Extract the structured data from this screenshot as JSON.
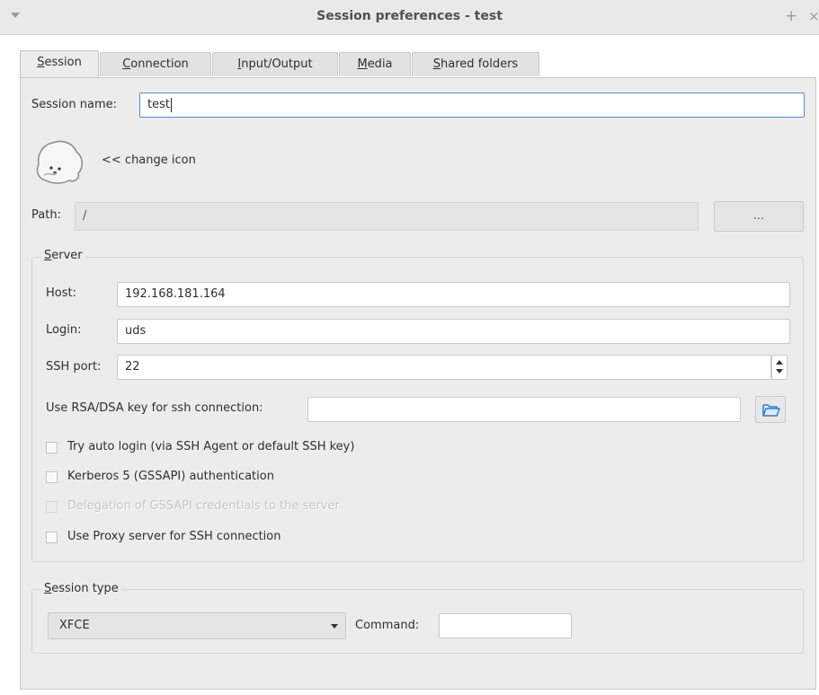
{
  "window": {
    "title": "Session preferences - test",
    "plus_glyph": "+",
    "close_glyph": "×"
  },
  "tabs": [
    {
      "label": "Session",
      "mnemonic": "S",
      "rest": "ession",
      "active": true
    },
    {
      "label": "Connection",
      "mnemonic": "C",
      "rest": "onnection",
      "active": false
    },
    {
      "label": "Input/Output",
      "mnemonic": "I",
      "rest": "nput/Output",
      "active": false
    },
    {
      "label": "Media",
      "mnemonic": "M",
      "rest": "edia",
      "active": false
    },
    {
      "label": "Shared folders",
      "mnemonic": "S",
      "rest": "hared folders",
      "active": false
    }
  ],
  "session": {
    "name_label": "Session name:",
    "name_value": "test",
    "change_icon_label": "<< change icon",
    "path_label": "Path:",
    "path_value": "/",
    "path_button_label": "..."
  },
  "server": {
    "legend_mnemonic": "S",
    "legend_rest": "erver",
    "host_label": "Host:",
    "host_value": "192.168.181.164",
    "login_label": "Login:",
    "login_value": "uds",
    "port_label": "SSH port:",
    "port_value": "22",
    "rsa_label": "Use RSA/DSA key for ssh connection:",
    "rsa_value": "",
    "checkboxes": [
      {
        "label": "Try auto login (via SSH Agent or default SSH key)",
        "checked": false,
        "enabled": true
      },
      {
        "label": "Kerberos 5 (GSSAPI) authentication",
        "checked": false,
        "enabled": true
      },
      {
        "label": "Delegation of GSSAPI credentials to the server",
        "checked": false,
        "enabled": false
      },
      {
        "label": "Use Proxy server for SSH connection",
        "checked": false,
        "enabled": true
      }
    ]
  },
  "session_type": {
    "legend_mnemonic": "S",
    "legend_rest": "ession type",
    "selected": "XFCE",
    "command_label": "Command:",
    "command_value": ""
  },
  "icons": {
    "session_icon": "seal-icon",
    "folder_button": "folder-open-icon"
  },
  "colors": {
    "focus_border": "#4d90c9",
    "panel_bg": "#ececec",
    "titlebar_bg": "#e9e9e9"
  }
}
